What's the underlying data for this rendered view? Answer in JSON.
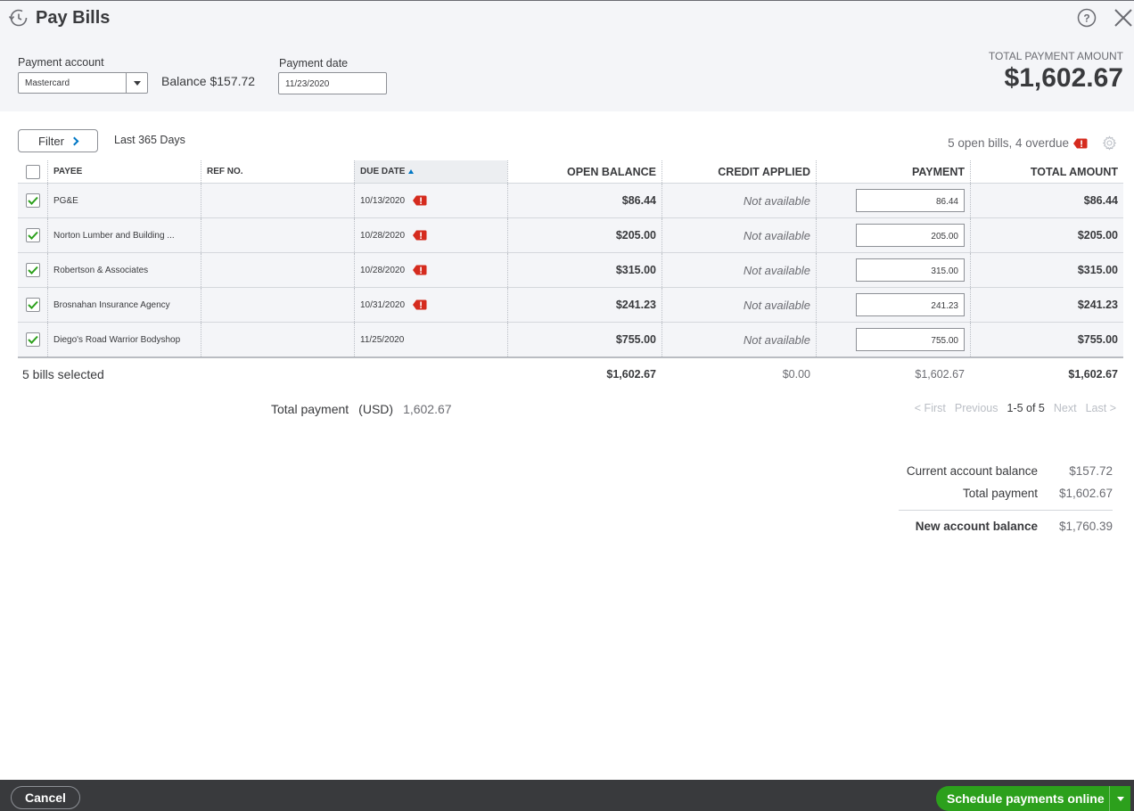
{
  "header": {
    "title": "Pay Bills",
    "payment_account_label": "Payment account",
    "payment_account_value": "Mastercard",
    "balance_label": "Balance",
    "balance_value": "$157.72",
    "payment_date_label": "Payment date",
    "payment_date_value": "11/23/2020",
    "total_payment_amount_label": "TOTAL PAYMENT AMOUNT",
    "total_payment_amount_value": "$1,602.67"
  },
  "filter": {
    "button_label": "Filter",
    "range_text": "Last 365 Days",
    "open_bills_text": "5 open bills, 4 overdue"
  },
  "table": {
    "columns": [
      "PAYEE",
      "REF NO.",
      "DUE DATE",
      "OPEN BALANCE",
      "CREDIT APPLIED",
      "PAYMENT",
      "TOTAL AMOUNT"
    ],
    "rows": [
      {
        "payee": "PG&E",
        "ref": "",
        "due_date": "10/13/2020",
        "overdue": true,
        "open_balance": "$86.44",
        "credit": "Not available",
        "payment": "86.44",
        "total": "$86.44",
        "checked": true
      },
      {
        "payee": "Norton Lumber and Building ...",
        "ref": "",
        "due_date": "10/28/2020",
        "overdue": true,
        "open_balance": "$205.00",
        "credit": "Not available",
        "payment": "205.00",
        "total": "$205.00",
        "checked": true
      },
      {
        "payee": "Robertson & Associates",
        "ref": "",
        "due_date": "10/28/2020",
        "overdue": true,
        "open_balance": "$315.00",
        "credit": "Not available",
        "payment": "315.00",
        "total": "$315.00",
        "checked": true
      },
      {
        "payee": "Brosnahan Insurance Agency",
        "ref": "",
        "due_date": "10/31/2020",
        "overdue": true,
        "open_balance": "$241.23",
        "credit": "Not available",
        "payment": "241.23",
        "total": "$241.23",
        "checked": true
      },
      {
        "payee": "Diego's Road Warrior Bodyshop",
        "ref": "",
        "due_date": "11/25/2020",
        "overdue": false,
        "open_balance": "$755.00",
        "credit": "Not available",
        "payment": "755.00",
        "total": "$755.00",
        "checked": true
      }
    ],
    "totals": {
      "selected_text": "5 bills selected",
      "open_balance": "$1,602.67",
      "credit": "$0.00",
      "payment": "$1,602.67",
      "total": "$1,602.67"
    }
  },
  "total_payment": {
    "label": "Total payment",
    "currency": "(USD)",
    "value": "1,602.67"
  },
  "pager": {
    "first": "< First",
    "previous": "Previous",
    "range": "1-5 of 5",
    "next": "Next",
    "last": "Last >"
  },
  "summary": {
    "current_balance_label": "Current account balance",
    "current_balance_value": "$157.72",
    "total_payment_label": "Total payment",
    "total_payment_value": "$1,602.67",
    "new_balance_label": "New account balance",
    "new_balance_value": "$1,760.39"
  },
  "footer": {
    "cancel_label": "Cancel",
    "schedule_label": "Schedule payments online"
  },
  "colors": {
    "accent_green": "#2ca01c",
    "overdue_red": "#d52b1e",
    "link_blue": "#0077c5",
    "footer_bg": "#393a3d"
  }
}
